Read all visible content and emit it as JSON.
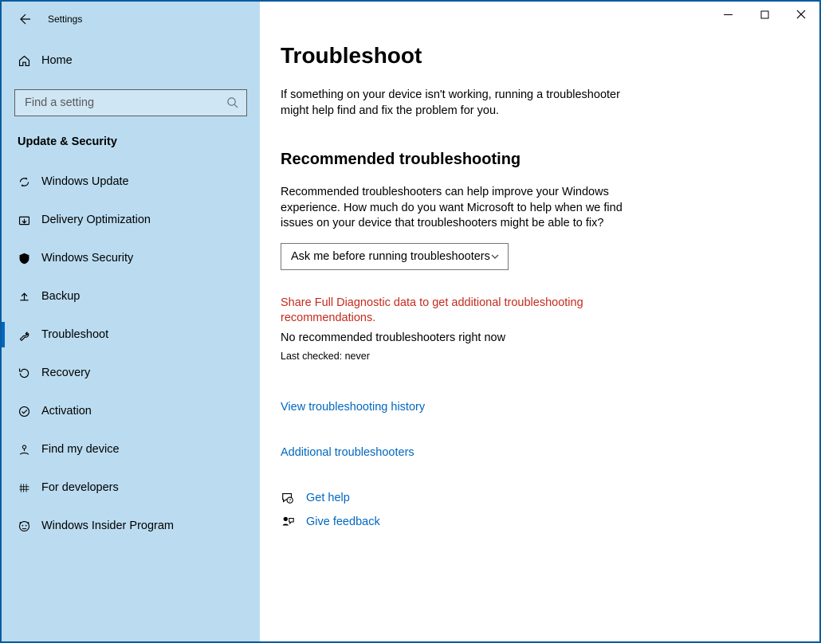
{
  "app_title": "Settings",
  "home_label": "Home",
  "search": {
    "placeholder": "Find a setting"
  },
  "section_header": "Update & Security",
  "nav": [
    {
      "label": "Windows Update"
    },
    {
      "label": "Delivery Optimization"
    },
    {
      "label": "Windows Security"
    },
    {
      "label": "Backup"
    },
    {
      "label": "Troubleshoot"
    },
    {
      "label": "Recovery"
    },
    {
      "label": "Activation"
    },
    {
      "label": "Find my device"
    },
    {
      "label": "For developers"
    },
    {
      "label": "Windows Insider Program"
    }
  ],
  "page": {
    "title": "Troubleshoot",
    "intro": "If something on your device isn't working, running a troubleshooter might help find and fix the problem for you.",
    "rec_heading": "Recommended troubleshooting",
    "rec_desc": "Recommended troubleshooters can help improve your Windows experience. How much do you want Microsoft to help when we find issues on your device that troubleshooters might be able to fix?",
    "combo_value": "Ask me before running troubleshooters",
    "diag_warning": "Share Full Diagnostic data to get additional troubleshooting recommendations.",
    "no_rec": "No recommended troubleshooters right now",
    "last_checked": "Last checked: never",
    "history_link": "View troubleshooting history",
    "additional_link": "Additional troubleshooters",
    "get_help": "Get help",
    "give_feedback": "Give feedback"
  }
}
